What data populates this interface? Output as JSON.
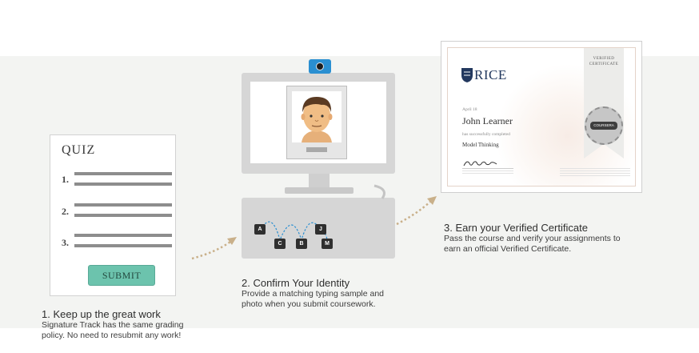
{
  "quiz": {
    "title": "QUIZ",
    "questions": [
      "1.",
      "2.",
      "3."
    ],
    "submit_label": "SUBMIT"
  },
  "steps": [
    {
      "title": "1. Keep up the great work",
      "description_lines": [
        "Signature Track has the same grading",
        "policy. No need to resubmit any work!"
      ]
    },
    {
      "title": "2. Confirm Your Identity",
      "description_lines": [
        "Provide a matching typing sample and",
        "photo when you submit coursework."
      ]
    },
    {
      "title": "3. Earn your Verified Certificate",
      "description_lines": [
        "Pass the course and verify your assignments to",
        "earn an official Verified Certificate."
      ]
    }
  ],
  "keyboard": {
    "keys": [
      "A",
      "C",
      "B",
      "J",
      "M"
    ]
  },
  "certificate": {
    "institution": "RICE",
    "ribbon_label_lines": [
      "VERIFIED",
      "CERTIFICATE"
    ],
    "date": "April 18",
    "recipient": "John Learner",
    "completed_text": "has successfully completed",
    "course": "Model Thinking",
    "signature": "Signature",
    "seal_text": "COURSERA"
  },
  "colors": {
    "submit_button": "#6cc3ad",
    "webcam": "#2a8fd1",
    "dotted_arrow": "#c9b08a",
    "keystroke_path": "#2a8fd1",
    "rice_blue": "#22385e"
  },
  "icons": {
    "webcam": "webcam-icon",
    "rice_shield": "shield-icon",
    "arrow": "dotted-arrow-icon"
  }
}
